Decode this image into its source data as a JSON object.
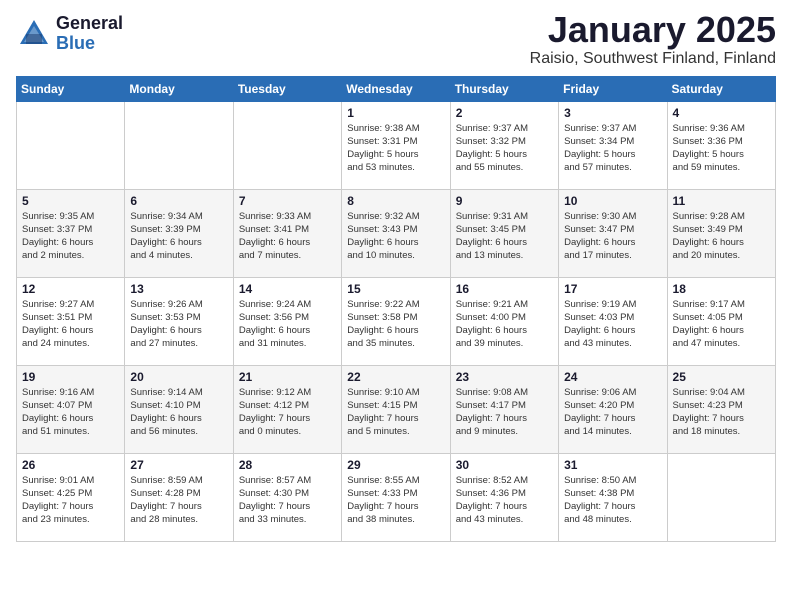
{
  "header": {
    "logo_general": "General",
    "logo_blue": "Blue",
    "month": "January 2025",
    "location": "Raisio, Southwest Finland, Finland"
  },
  "days_of_week": [
    "Sunday",
    "Monday",
    "Tuesday",
    "Wednesday",
    "Thursday",
    "Friday",
    "Saturday"
  ],
  "weeks": [
    [
      {
        "day": "",
        "info": ""
      },
      {
        "day": "",
        "info": ""
      },
      {
        "day": "",
        "info": ""
      },
      {
        "day": "1",
        "info": "Sunrise: 9:38 AM\nSunset: 3:31 PM\nDaylight: 5 hours\nand 53 minutes."
      },
      {
        "day": "2",
        "info": "Sunrise: 9:37 AM\nSunset: 3:32 PM\nDaylight: 5 hours\nand 55 minutes."
      },
      {
        "day": "3",
        "info": "Sunrise: 9:37 AM\nSunset: 3:34 PM\nDaylight: 5 hours\nand 57 minutes."
      },
      {
        "day": "4",
        "info": "Sunrise: 9:36 AM\nSunset: 3:36 PM\nDaylight: 5 hours\nand 59 minutes."
      }
    ],
    [
      {
        "day": "5",
        "info": "Sunrise: 9:35 AM\nSunset: 3:37 PM\nDaylight: 6 hours\nand 2 minutes."
      },
      {
        "day": "6",
        "info": "Sunrise: 9:34 AM\nSunset: 3:39 PM\nDaylight: 6 hours\nand 4 minutes."
      },
      {
        "day": "7",
        "info": "Sunrise: 9:33 AM\nSunset: 3:41 PM\nDaylight: 6 hours\nand 7 minutes."
      },
      {
        "day": "8",
        "info": "Sunrise: 9:32 AM\nSunset: 3:43 PM\nDaylight: 6 hours\nand 10 minutes."
      },
      {
        "day": "9",
        "info": "Sunrise: 9:31 AM\nSunset: 3:45 PM\nDaylight: 6 hours\nand 13 minutes."
      },
      {
        "day": "10",
        "info": "Sunrise: 9:30 AM\nSunset: 3:47 PM\nDaylight: 6 hours\nand 17 minutes."
      },
      {
        "day": "11",
        "info": "Sunrise: 9:28 AM\nSunset: 3:49 PM\nDaylight: 6 hours\nand 20 minutes."
      }
    ],
    [
      {
        "day": "12",
        "info": "Sunrise: 9:27 AM\nSunset: 3:51 PM\nDaylight: 6 hours\nand 24 minutes."
      },
      {
        "day": "13",
        "info": "Sunrise: 9:26 AM\nSunset: 3:53 PM\nDaylight: 6 hours\nand 27 minutes."
      },
      {
        "day": "14",
        "info": "Sunrise: 9:24 AM\nSunset: 3:56 PM\nDaylight: 6 hours\nand 31 minutes."
      },
      {
        "day": "15",
        "info": "Sunrise: 9:22 AM\nSunset: 3:58 PM\nDaylight: 6 hours\nand 35 minutes."
      },
      {
        "day": "16",
        "info": "Sunrise: 9:21 AM\nSunset: 4:00 PM\nDaylight: 6 hours\nand 39 minutes."
      },
      {
        "day": "17",
        "info": "Sunrise: 9:19 AM\nSunset: 4:03 PM\nDaylight: 6 hours\nand 43 minutes."
      },
      {
        "day": "18",
        "info": "Sunrise: 9:17 AM\nSunset: 4:05 PM\nDaylight: 6 hours\nand 47 minutes."
      }
    ],
    [
      {
        "day": "19",
        "info": "Sunrise: 9:16 AM\nSunset: 4:07 PM\nDaylight: 6 hours\nand 51 minutes."
      },
      {
        "day": "20",
        "info": "Sunrise: 9:14 AM\nSunset: 4:10 PM\nDaylight: 6 hours\nand 56 minutes."
      },
      {
        "day": "21",
        "info": "Sunrise: 9:12 AM\nSunset: 4:12 PM\nDaylight: 7 hours\nand 0 minutes."
      },
      {
        "day": "22",
        "info": "Sunrise: 9:10 AM\nSunset: 4:15 PM\nDaylight: 7 hours\nand 5 minutes."
      },
      {
        "day": "23",
        "info": "Sunrise: 9:08 AM\nSunset: 4:17 PM\nDaylight: 7 hours\nand 9 minutes."
      },
      {
        "day": "24",
        "info": "Sunrise: 9:06 AM\nSunset: 4:20 PM\nDaylight: 7 hours\nand 14 minutes."
      },
      {
        "day": "25",
        "info": "Sunrise: 9:04 AM\nSunset: 4:23 PM\nDaylight: 7 hours\nand 18 minutes."
      }
    ],
    [
      {
        "day": "26",
        "info": "Sunrise: 9:01 AM\nSunset: 4:25 PM\nDaylight: 7 hours\nand 23 minutes."
      },
      {
        "day": "27",
        "info": "Sunrise: 8:59 AM\nSunset: 4:28 PM\nDaylight: 7 hours\nand 28 minutes."
      },
      {
        "day": "28",
        "info": "Sunrise: 8:57 AM\nSunset: 4:30 PM\nDaylight: 7 hours\nand 33 minutes."
      },
      {
        "day": "29",
        "info": "Sunrise: 8:55 AM\nSunset: 4:33 PM\nDaylight: 7 hours\nand 38 minutes."
      },
      {
        "day": "30",
        "info": "Sunrise: 8:52 AM\nSunset: 4:36 PM\nDaylight: 7 hours\nand 43 minutes."
      },
      {
        "day": "31",
        "info": "Sunrise: 8:50 AM\nSunset: 4:38 PM\nDaylight: 7 hours\nand 48 minutes."
      },
      {
        "day": "",
        "info": ""
      }
    ]
  ]
}
